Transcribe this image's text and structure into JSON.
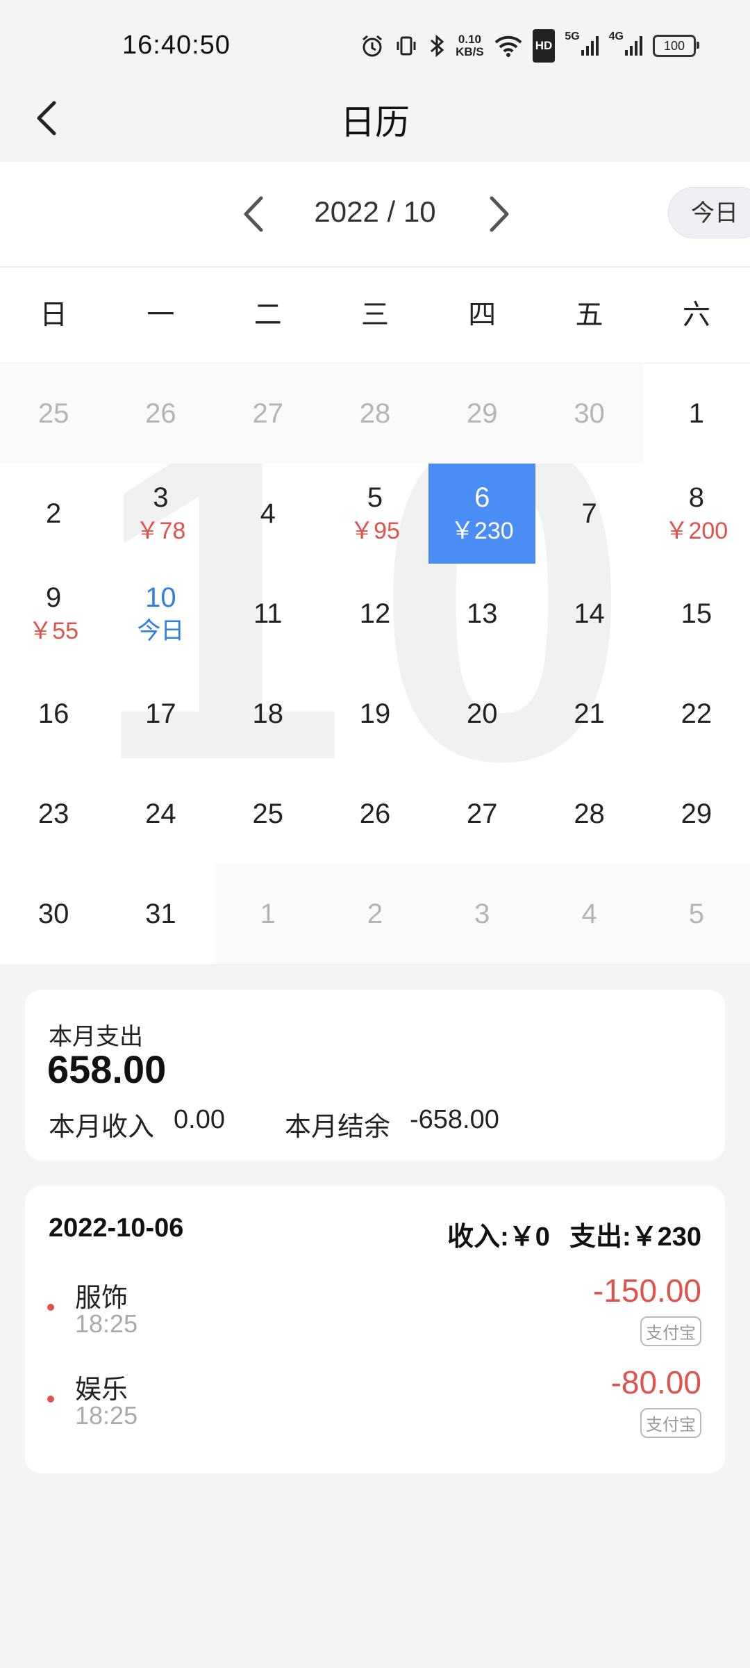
{
  "status_bar": {
    "time": "16:40:50",
    "net_speed_value": "0.10",
    "net_speed_unit": "KB/S",
    "hd_label": "HD",
    "sig1_label": "5G",
    "sig2_label": "4G",
    "battery": "100"
  },
  "header": {
    "title": "日历"
  },
  "month_bar": {
    "label": "2022 / 10",
    "today_button": "今日"
  },
  "weekdays": [
    "日",
    "一",
    "二",
    "三",
    "四",
    "五",
    "六"
  ],
  "watermark": "10",
  "calendar": [
    [
      {
        "d": "25",
        "o": true
      },
      {
        "d": "26",
        "o": true
      },
      {
        "d": "27",
        "o": true
      },
      {
        "d": "28",
        "o": true
      },
      {
        "d": "29",
        "o": true
      },
      {
        "d": "30",
        "o": true
      },
      {
        "d": "1"
      }
    ],
    [
      {
        "d": "2"
      },
      {
        "d": "3",
        "a": "￥78"
      },
      {
        "d": "4"
      },
      {
        "d": "5",
        "a": "￥95"
      },
      {
        "d": "6",
        "a": "￥230",
        "sel": true
      },
      {
        "d": "7"
      },
      {
        "d": "8",
        "a": "￥200"
      }
    ],
    [
      {
        "d": "9",
        "a": "￥55"
      },
      {
        "d": "10",
        "a": "今日",
        "today": true
      },
      {
        "d": "11"
      },
      {
        "d": "12"
      },
      {
        "d": "13"
      },
      {
        "d": "14"
      },
      {
        "d": "15"
      }
    ],
    [
      {
        "d": "16"
      },
      {
        "d": "17"
      },
      {
        "d": "18"
      },
      {
        "d": "19"
      },
      {
        "d": "20"
      },
      {
        "d": "21"
      },
      {
        "d": "22"
      }
    ],
    [
      {
        "d": "23"
      },
      {
        "d": "24"
      },
      {
        "d": "25"
      },
      {
        "d": "26"
      },
      {
        "d": "27"
      },
      {
        "d": "28"
      },
      {
        "d": "29"
      }
    ],
    [
      {
        "d": "30"
      },
      {
        "d": "31"
      },
      {
        "d": "1",
        "o": true
      },
      {
        "d": "2",
        "o": true
      },
      {
        "d": "3",
        "o": true
      },
      {
        "d": "4",
        "o": true
      },
      {
        "d": "5",
        "o": true
      }
    ]
  ],
  "summary": {
    "expense_label": "本月支出",
    "expense_value": "658.00",
    "income_label": "本月收入",
    "income_value": "0.00",
    "balance_label": "本月结余",
    "balance_value": "-658.00"
  },
  "detail": {
    "date": "2022-10-06",
    "income_total": "收入:￥0",
    "expense_total": "支出:￥230",
    "transactions": [
      {
        "category": "服饰",
        "time": "18:25",
        "amount": "-150.00",
        "payment": "支付宝"
      },
      {
        "category": "娱乐",
        "time": "18:25",
        "amount": "-80.00",
        "payment": "支付宝"
      }
    ]
  },
  "colors": {
    "accent": "#4a8ef5",
    "today": "#2f7fe8",
    "expense": "#e0524b"
  }
}
